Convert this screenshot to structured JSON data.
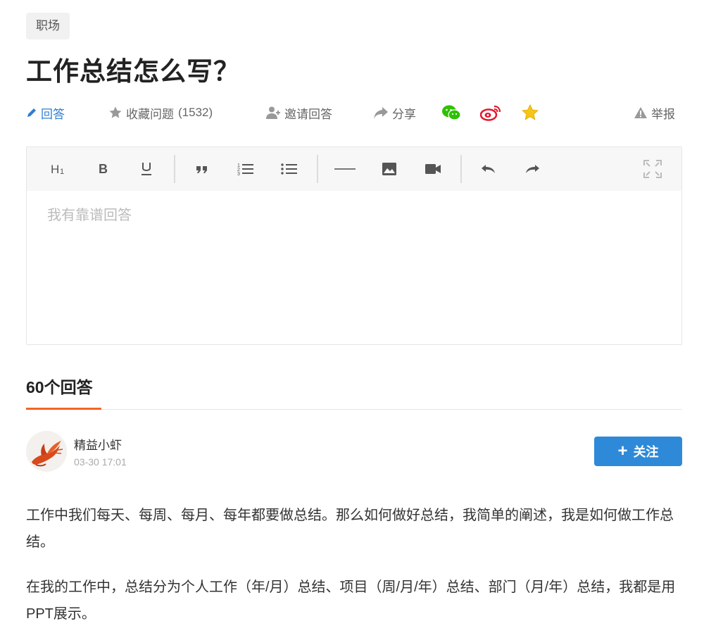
{
  "tag": "职场",
  "title": "工作总结怎么写？",
  "actions": {
    "answer": "回答",
    "collect": "收藏问题",
    "collect_count": "(1532)",
    "invite": "邀请回答",
    "share": "分享",
    "report": "举报"
  },
  "editor": {
    "placeholder": "我有靠谱回答",
    "toolbar": [
      "heading-icon",
      "bold-icon",
      "underline-icon",
      "quote-icon",
      "ordered-list-icon",
      "bullet-list-icon",
      "horizontal-rule-icon",
      "image-icon",
      "video-icon",
      "undo-icon",
      "redo-icon",
      "fullscreen-icon"
    ]
  },
  "answers": {
    "count_label": "60个回答"
  },
  "answer": {
    "author": "精益小虾",
    "time": "03-30 17:01",
    "follow_label": "关注",
    "paragraphs": [
      "工作中我们每天、每周、每月、每年都要做总结。那么如何做好总结，我简单的阐述，我是如何做工作总结。",
      "在我的工作中，总结分为个人工作（年/月）总结、项目（周/月/年）总结、部门（月/年）总结，我都是用PPT展示。"
    ]
  },
  "colors": {
    "accent_blue": "#2e8ad8",
    "link_blue": "#2e7fcf",
    "tab_orange": "#f26522",
    "wechat_green": "#2dc100",
    "weibo_red": "#e6162d",
    "star_yellow": "#f5c518"
  }
}
